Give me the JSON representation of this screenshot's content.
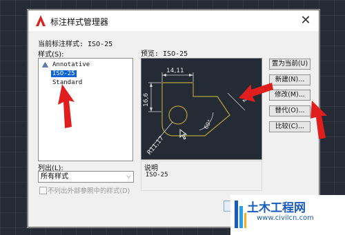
{
  "window": {
    "title": "标注样式管理器",
    "close_glyph": "✕"
  },
  "current_style": {
    "label": "当前标注样式: ISO-25"
  },
  "styles": {
    "label": "样式(S):",
    "items": [
      "Annotative",
      "ISO-25",
      "Standard"
    ],
    "selected": "ISO-25"
  },
  "list_filter": {
    "label": "列出(L):",
    "value": "所有样式",
    "arrow": "⌵"
  },
  "xref_checkbox": {
    "label": "不列出外部参照中的样式(D)",
    "checked": false
  },
  "preview": {
    "label": "预览: ISO-25",
    "dims": {
      "top": "14,11",
      "left": "16,6",
      "right": "2",
      "angle": "60°",
      "radius": "R11,17"
    }
  },
  "description": {
    "label": "说明",
    "value": "ISO-25"
  },
  "buttons": {
    "set_current": "置为当前(U)",
    "new": "新建(N)...",
    "modify": "修改(M)...",
    "override": "替代(O)...",
    "compare": "比较(C)..."
  },
  "watermark": {
    "title": "土木工程网",
    "url": "www.civilcn.com"
  },
  "colors": {
    "accent": "#0a64d8",
    "preview_bg": "#252b35",
    "geometry": "#b7a23a",
    "annotation": "#e11e1e"
  }
}
